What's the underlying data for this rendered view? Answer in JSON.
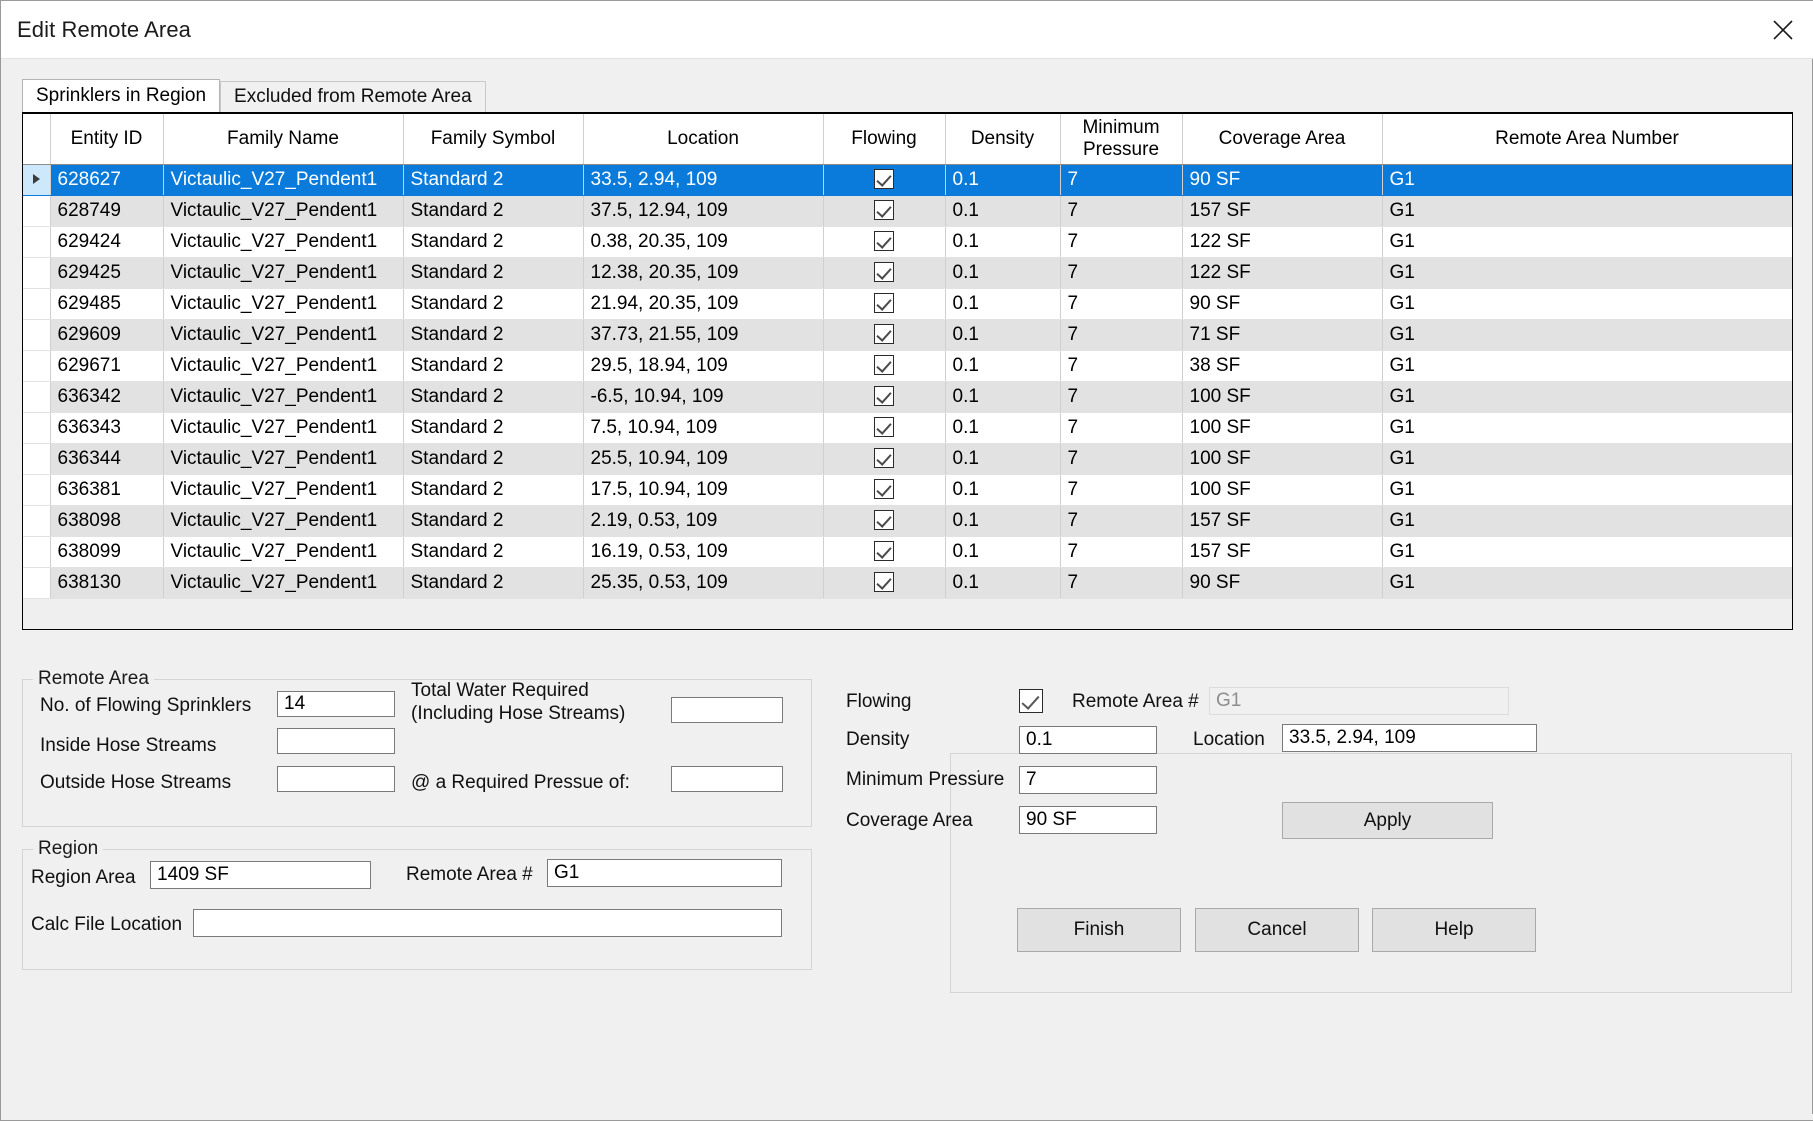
{
  "window": {
    "title": "Edit Remote Area",
    "close_icon": "close-icon"
  },
  "tabs": [
    {
      "label": "Sprinklers in Region",
      "active": true
    },
    {
      "label": "Excluded from Remote Area",
      "active": false
    }
  ],
  "grid": {
    "columns": [
      "Entity ID",
      "Family Name",
      "Family Symbol",
      "Location",
      "Flowing",
      "Density",
      "Minimum Pressure",
      "Coverage Area",
      "Remote Area Number"
    ],
    "rows": [
      {
        "entity_id": "628627",
        "family_name": "Victaulic_V27_Pendent1",
        "family_symbol": "Standard 2",
        "location": "33.5, 2.94, 109",
        "flowing": true,
        "density": "0.1",
        "minimum_pressure": "7",
        "coverage_area": "90 SF",
        "remote_area_number": "G1",
        "selected": true
      },
      {
        "entity_id": "628749",
        "family_name": "Victaulic_V27_Pendent1",
        "family_symbol": "Standard 2",
        "location": "37.5, 12.94, 109",
        "flowing": true,
        "density": "0.1",
        "minimum_pressure": "7",
        "coverage_area": "157 SF",
        "remote_area_number": "G1",
        "selected": false
      },
      {
        "entity_id": "629424",
        "family_name": "Victaulic_V27_Pendent1",
        "family_symbol": "Standard 2",
        "location": "0.38, 20.35, 109",
        "flowing": true,
        "density": "0.1",
        "minimum_pressure": "7",
        "coverage_area": "122 SF",
        "remote_area_number": "G1",
        "selected": false
      },
      {
        "entity_id": "629425",
        "family_name": "Victaulic_V27_Pendent1",
        "family_symbol": "Standard 2",
        "location": "12.38, 20.35, 109",
        "flowing": true,
        "density": "0.1",
        "minimum_pressure": "7",
        "coverage_area": "122 SF",
        "remote_area_number": "G1",
        "selected": false
      },
      {
        "entity_id": "629485",
        "family_name": "Victaulic_V27_Pendent1",
        "family_symbol": "Standard 2",
        "location": "21.94, 20.35, 109",
        "flowing": true,
        "density": "0.1",
        "minimum_pressure": "7",
        "coverage_area": "90 SF",
        "remote_area_number": "G1",
        "selected": false
      },
      {
        "entity_id": "629609",
        "family_name": "Victaulic_V27_Pendent1",
        "family_symbol": "Standard 2",
        "location": "37.73, 21.55, 109",
        "flowing": true,
        "density": "0.1",
        "minimum_pressure": "7",
        "coverage_area": "71 SF",
        "remote_area_number": "G1",
        "selected": false
      },
      {
        "entity_id": "629671",
        "family_name": "Victaulic_V27_Pendent1",
        "family_symbol": "Standard 2",
        "location": "29.5, 18.94, 109",
        "flowing": true,
        "density": "0.1",
        "minimum_pressure": "7",
        "coverage_area": "38 SF",
        "remote_area_number": "G1",
        "selected": false
      },
      {
        "entity_id": "636342",
        "family_name": "Victaulic_V27_Pendent1",
        "family_symbol": "Standard 2",
        "location": "-6.5, 10.94, 109",
        "flowing": true,
        "density": "0.1",
        "minimum_pressure": "7",
        "coverage_area": "100 SF",
        "remote_area_number": "G1",
        "selected": false
      },
      {
        "entity_id": "636343",
        "family_name": "Victaulic_V27_Pendent1",
        "family_symbol": "Standard 2",
        "location": "7.5, 10.94, 109",
        "flowing": true,
        "density": "0.1",
        "minimum_pressure": "7",
        "coverage_area": "100 SF",
        "remote_area_number": "G1",
        "selected": false
      },
      {
        "entity_id": "636344",
        "family_name": "Victaulic_V27_Pendent1",
        "family_symbol": "Standard 2",
        "location": "25.5, 10.94, 109",
        "flowing": true,
        "density": "0.1",
        "minimum_pressure": "7",
        "coverage_area": "100 SF",
        "remote_area_number": "G1",
        "selected": false
      },
      {
        "entity_id": "636381",
        "family_name": "Victaulic_V27_Pendent1",
        "family_symbol": "Standard 2",
        "location": "17.5, 10.94, 109",
        "flowing": true,
        "density": "0.1",
        "minimum_pressure": "7",
        "coverage_area": "100 SF",
        "remote_area_number": "G1",
        "selected": false
      },
      {
        "entity_id": "638098",
        "family_name": "Victaulic_V27_Pendent1",
        "family_symbol": "Standard 2",
        "location": "2.19, 0.53, 109",
        "flowing": true,
        "density": "0.1",
        "minimum_pressure": "7",
        "coverage_area": "157 SF",
        "remote_area_number": "G1",
        "selected": false
      },
      {
        "entity_id": "638099",
        "family_name": "Victaulic_V27_Pendent1",
        "family_symbol": "Standard 2",
        "location": "16.19, 0.53, 109",
        "flowing": true,
        "density": "0.1",
        "minimum_pressure": "7",
        "coverage_area": "157 SF",
        "remote_area_number": "G1",
        "selected": false
      },
      {
        "entity_id": "638130",
        "family_name": "Victaulic_V27_Pendent1",
        "family_symbol": "Standard 2",
        "location": "25.35, 0.53, 109",
        "flowing": true,
        "density": "0.1",
        "minimum_pressure": "7",
        "coverage_area": "90 SF",
        "remote_area_number": "G1",
        "selected": false
      }
    ]
  },
  "remote_area_group": {
    "legend": "Remote Area",
    "no_of_flowing_sprinklers_label": "No. of Flowing Sprinklers",
    "no_of_flowing_sprinklers_value": "14",
    "inside_hose_streams_label": "Inside Hose Streams",
    "inside_hose_streams_value": "",
    "outside_hose_streams_label": "Outside Hose Streams",
    "outside_hose_streams_value": "",
    "total_water_required_label_line1": "Total Water Required",
    "total_water_required_label_line2": "(Including Hose Streams)",
    "total_water_required_value": "",
    "required_pressure_label": "@ a Required Pressue of:",
    "required_pressure_value": ""
  },
  "region_group": {
    "legend": "Region",
    "region_area_label": "Region Area",
    "region_area_value": "1409 SF",
    "remote_area_number_label": "Remote Area #",
    "remote_area_number_value": "G1",
    "calc_file_location_label": "Calc File Location",
    "calc_file_location_value": ""
  },
  "selected_sprinkler_panel": {
    "flowing_label": "Flowing",
    "flowing_checked": true,
    "density_label": "Density",
    "density_value": "0.1",
    "minimum_pressure_label": "Minimum Pressure",
    "minimum_pressure_value": "7",
    "coverage_area_label": "Coverage Area",
    "coverage_area_value": "90 SF",
    "remote_area_number_label": "Remote Area #",
    "remote_area_number_value": "G1",
    "location_label": "Location",
    "location_value": "33.5, 2.94, 109",
    "apply_label": "Apply"
  },
  "footer": {
    "finish_label": "Finish",
    "cancel_label": "Cancel",
    "help_label": "Help"
  },
  "colors": {
    "selection_blue": "#0a7bdb",
    "selection_row_header": "#cde8fb",
    "dialog_bg": "#f0f0f0",
    "alt_row": "#e2e2e2"
  }
}
